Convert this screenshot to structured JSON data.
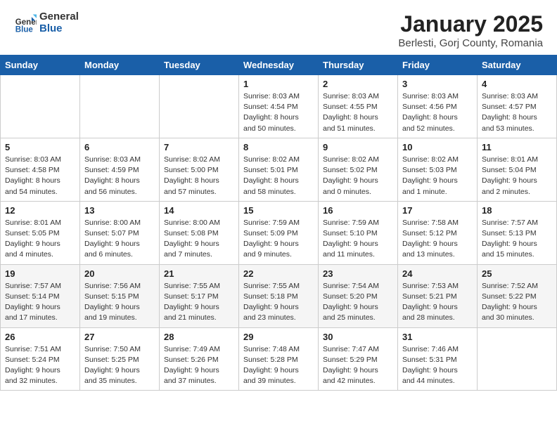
{
  "header": {
    "logo_general": "General",
    "logo_blue": "Blue",
    "month": "January 2025",
    "location": "Berlesti, Gorj County, Romania"
  },
  "days_of_week": [
    "Sunday",
    "Monday",
    "Tuesday",
    "Wednesday",
    "Thursday",
    "Friday",
    "Saturday"
  ],
  "weeks": [
    [
      {
        "day": "",
        "info": ""
      },
      {
        "day": "",
        "info": ""
      },
      {
        "day": "",
        "info": ""
      },
      {
        "day": "1",
        "info": "Sunrise: 8:03 AM\nSunset: 4:54 PM\nDaylight: 8 hours\nand 50 minutes."
      },
      {
        "day": "2",
        "info": "Sunrise: 8:03 AM\nSunset: 4:55 PM\nDaylight: 8 hours\nand 51 minutes."
      },
      {
        "day": "3",
        "info": "Sunrise: 8:03 AM\nSunset: 4:56 PM\nDaylight: 8 hours\nand 52 minutes."
      },
      {
        "day": "4",
        "info": "Sunrise: 8:03 AM\nSunset: 4:57 PM\nDaylight: 8 hours\nand 53 minutes."
      }
    ],
    [
      {
        "day": "5",
        "info": "Sunrise: 8:03 AM\nSunset: 4:58 PM\nDaylight: 8 hours\nand 54 minutes."
      },
      {
        "day": "6",
        "info": "Sunrise: 8:03 AM\nSunset: 4:59 PM\nDaylight: 8 hours\nand 56 minutes."
      },
      {
        "day": "7",
        "info": "Sunrise: 8:02 AM\nSunset: 5:00 PM\nDaylight: 8 hours\nand 57 minutes."
      },
      {
        "day": "8",
        "info": "Sunrise: 8:02 AM\nSunset: 5:01 PM\nDaylight: 8 hours\nand 58 minutes."
      },
      {
        "day": "9",
        "info": "Sunrise: 8:02 AM\nSunset: 5:02 PM\nDaylight: 9 hours\nand 0 minutes."
      },
      {
        "day": "10",
        "info": "Sunrise: 8:02 AM\nSunset: 5:03 PM\nDaylight: 9 hours\nand 1 minute."
      },
      {
        "day": "11",
        "info": "Sunrise: 8:01 AM\nSunset: 5:04 PM\nDaylight: 9 hours\nand 2 minutes."
      }
    ],
    [
      {
        "day": "12",
        "info": "Sunrise: 8:01 AM\nSunset: 5:05 PM\nDaylight: 9 hours\nand 4 minutes."
      },
      {
        "day": "13",
        "info": "Sunrise: 8:00 AM\nSunset: 5:07 PM\nDaylight: 9 hours\nand 6 minutes."
      },
      {
        "day": "14",
        "info": "Sunrise: 8:00 AM\nSunset: 5:08 PM\nDaylight: 9 hours\nand 7 minutes."
      },
      {
        "day": "15",
        "info": "Sunrise: 7:59 AM\nSunset: 5:09 PM\nDaylight: 9 hours\nand 9 minutes."
      },
      {
        "day": "16",
        "info": "Sunrise: 7:59 AM\nSunset: 5:10 PM\nDaylight: 9 hours\nand 11 minutes."
      },
      {
        "day": "17",
        "info": "Sunrise: 7:58 AM\nSunset: 5:12 PM\nDaylight: 9 hours\nand 13 minutes."
      },
      {
        "day": "18",
        "info": "Sunrise: 7:57 AM\nSunset: 5:13 PM\nDaylight: 9 hours\nand 15 minutes."
      }
    ],
    [
      {
        "day": "19",
        "info": "Sunrise: 7:57 AM\nSunset: 5:14 PM\nDaylight: 9 hours\nand 17 minutes."
      },
      {
        "day": "20",
        "info": "Sunrise: 7:56 AM\nSunset: 5:15 PM\nDaylight: 9 hours\nand 19 minutes."
      },
      {
        "day": "21",
        "info": "Sunrise: 7:55 AM\nSunset: 5:17 PM\nDaylight: 9 hours\nand 21 minutes."
      },
      {
        "day": "22",
        "info": "Sunrise: 7:55 AM\nSunset: 5:18 PM\nDaylight: 9 hours\nand 23 minutes."
      },
      {
        "day": "23",
        "info": "Sunrise: 7:54 AM\nSunset: 5:20 PM\nDaylight: 9 hours\nand 25 minutes."
      },
      {
        "day": "24",
        "info": "Sunrise: 7:53 AM\nSunset: 5:21 PM\nDaylight: 9 hours\nand 28 minutes."
      },
      {
        "day": "25",
        "info": "Sunrise: 7:52 AM\nSunset: 5:22 PM\nDaylight: 9 hours\nand 30 minutes."
      }
    ],
    [
      {
        "day": "26",
        "info": "Sunrise: 7:51 AM\nSunset: 5:24 PM\nDaylight: 9 hours\nand 32 minutes."
      },
      {
        "day": "27",
        "info": "Sunrise: 7:50 AM\nSunset: 5:25 PM\nDaylight: 9 hours\nand 35 minutes."
      },
      {
        "day": "28",
        "info": "Sunrise: 7:49 AM\nSunset: 5:26 PM\nDaylight: 9 hours\nand 37 minutes."
      },
      {
        "day": "29",
        "info": "Sunrise: 7:48 AM\nSunset: 5:28 PM\nDaylight: 9 hours\nand 39 minutes."
      },
      {
        "day": "30",
        "info": "Sunrise: 7:47 AM\nSunset: 5:29 PM\nDaylight: 9 hours\nand 42 minutes."
      },
      {
        "day": "31",
        "info": "Sunrise: 7:46 AM\nSunset: 5:31 PM\nDaylight: 9 hours\nand 44 minutes."
      },
      {
        "day": "",
        "info": ""
      }
    ]
  ]
}
